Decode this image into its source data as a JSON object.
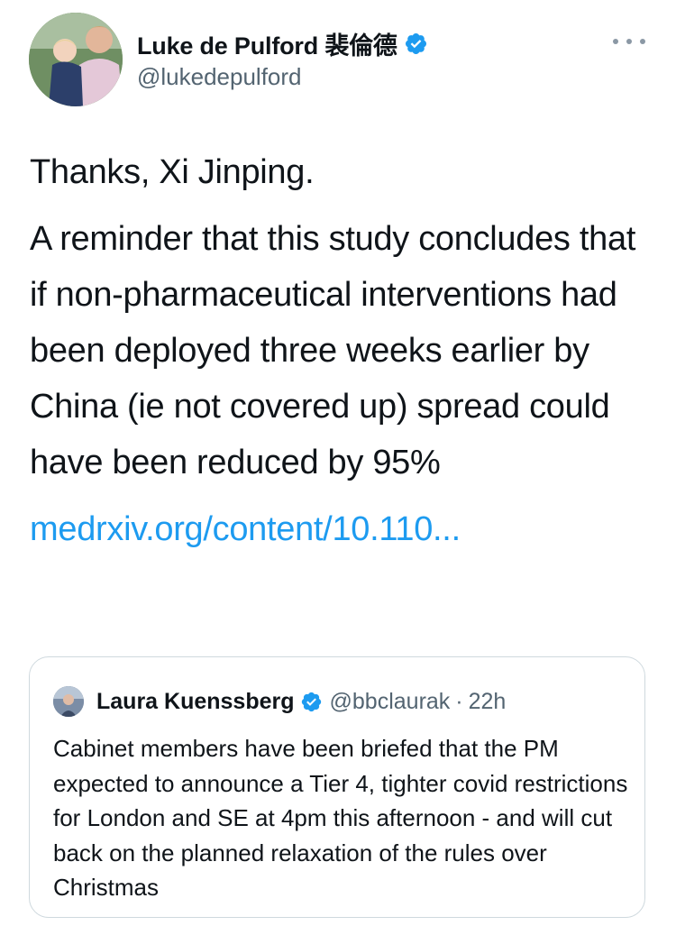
{
  "author": {
    "display_name": "Luke de Pulford 裴倫德",
    "handle": "@lukedepulford",
    "verified": true
  },
  "tweet": {
    "paragraphs": [
      "Thanks, Xi Jinping.",
      "A reminder that this study concludes that if non-pharmaceutical interventions had been deployed three weeks earlier by China (ie not covered up) spread could have been reduced by 95%"
    ],
    "link_text": "medrxiv.org/content/10.110..."
  },
  "quoted_tweet": {
    "display_name": "Laura Kuenssberg",
    "handle": "@bbclaurak",
    "separator": "·",
    "time": "22h",
    "verified": true,
    "text": "Cabinet members have been briefed that the PM expected to announce a Tier 4,  tighter covid restrictions for London and SE at 4pm this afternoon - and will cut back on the planned relaxation of the rules over Christmas"
  },
  "icons": {
    "verified": "verified-badge-icon",
    "more": "more-options-icon"
  },
  "colors": {
    "link": "#1d9bf0",
    "verified": "#1d9bf0",
    "secondary_text": "#536471",
    "border": "#cfd9de"
  }
}
